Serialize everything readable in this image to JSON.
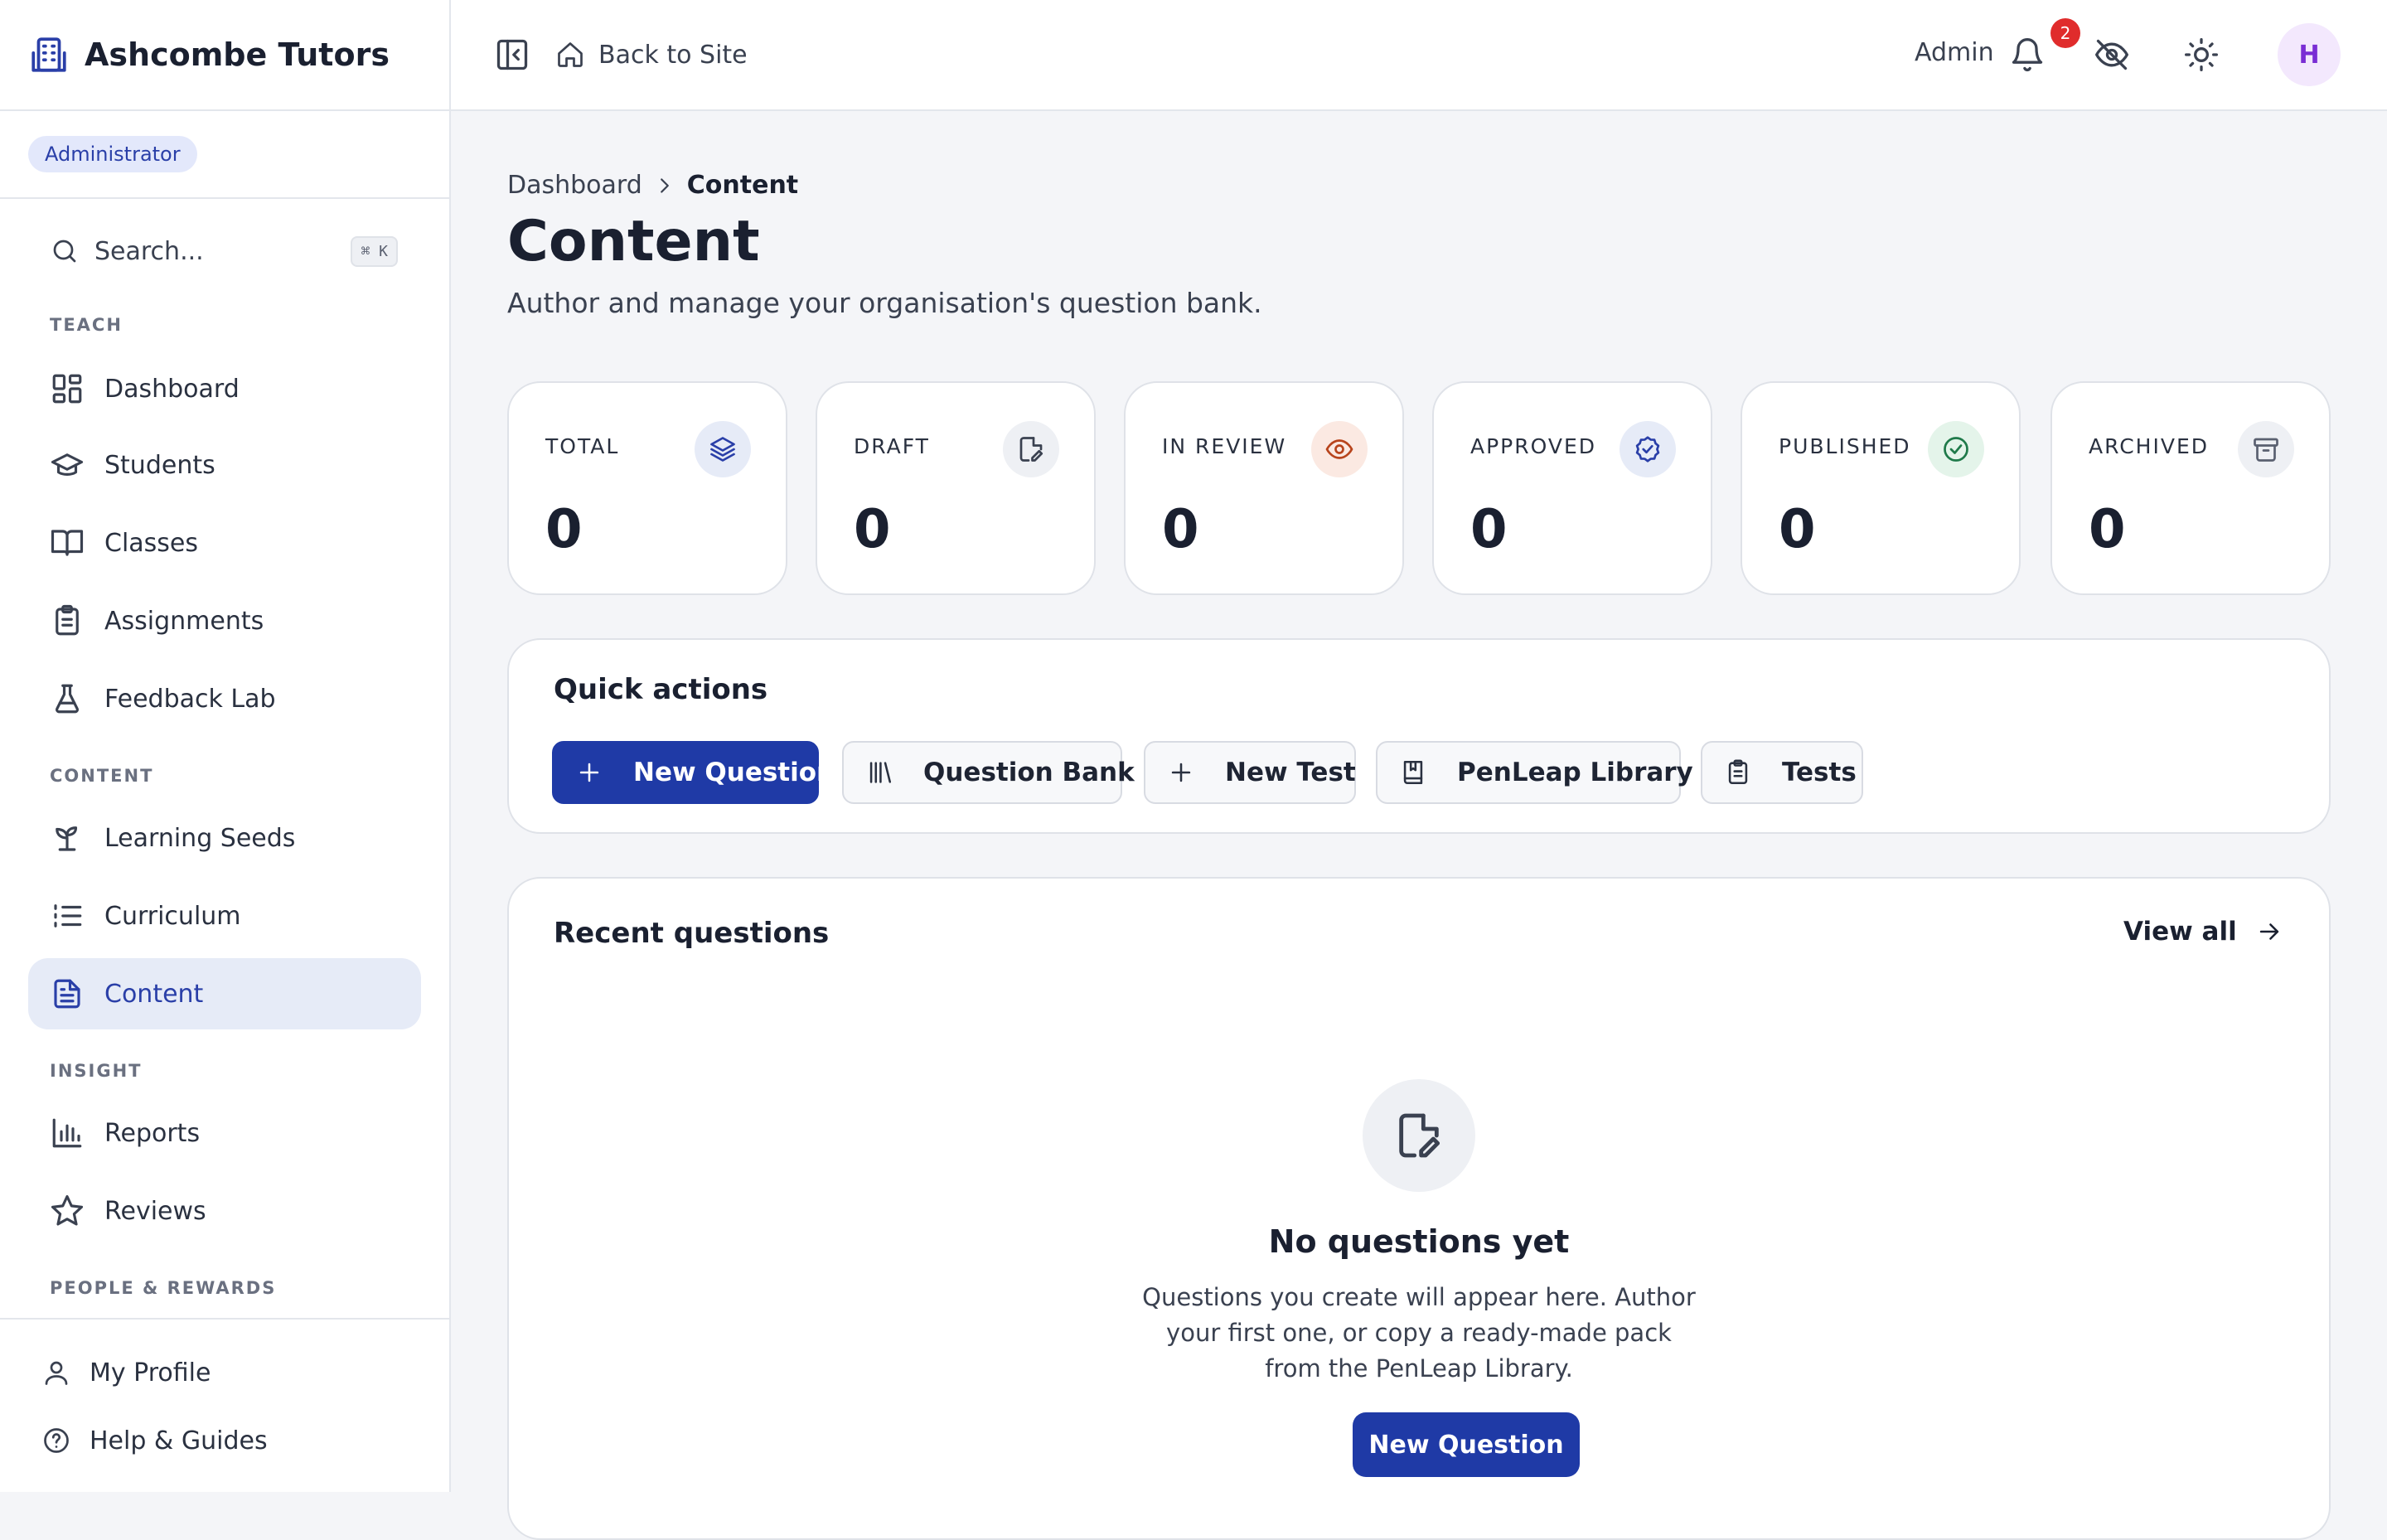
{
  "brand": {
    "name": "Ashcombe Tutors",
    "role": "Administrator"
  },
  "sidebar": {
    "search_label": "Search...",
    "search_shortcut": "⌘ K",
    "sections": [
      {
        "label": "TEACH"
      },
      {
        "label": "CONTENT"
      },
      {
        "label": "INSIGHT"
      },
      {
        "label": "PEOPLE & REWARDS"
      }
    ],
    "items": [
      {
        "label": "Dashboard",
        "icon": "dashboard-icon"
      },
      {
        "label": "Students",
        "icon": "graduation-cap-icon"
      },
      {
        "label": "Classes",
        "icon": "book-open-icon"
      },
      {
        "label": "Assignments",
        "icon": "clipboard-icon"
      },
      {
        "label": "Feedback Lab",
        "icon": "flask-icon"
      },
      {
        "label": "Learning Seeds",
        "icon": "sprout-icon"
      },
      {
        "label": "Curriculum",
        "icon": "list-icon"
      },
      {
        "label": "Content",
        "icon": "file-text-icon",
        "active": true
      },
      {
        "label": "Reports",
        "icon": "bar-chart-icon"
      },
      {
        "label": "Reviews",
        "icon": "star-icon"
      }
    ],
    "bottom": [
      {
        "label": "My Profile",
        "icon": "user-icon"
      },
      {
        "label": "Help & Guides",
        "icon": "help-circle-icon"
      }
    ]
  },
  "topbar": {
    "back_label": "Back to Site",
    "user_label": "Admin",
    "notification_count": "2",
    "avatar_initial": "H"
  },
  "breadcrumb": {
    "parent": "Dashboard",
    "current": "Content"
  },
  "page": {
    "title": "Content",
    "subtitle": "Author and manage your organisation's question bank."
  },
  "stats": [
    {
      "label": "TOTAL",
      "value": "0",
      "icon": "layers-icon",
      "color": "#2a3fa8",
      "bg": "#e6ebf7"
    },
    {
      "label": "DRAFT",
      "value": "0",
      "icon": "file-edit-icon",
      "color": "#3a4150",
      "bg": "#eef0f4"
    },
    {
      "label": "IN REVIEW",
      "value": "0",
      "icon": "eye-icon",
      "color": "#b8441c",
      "bg": "#fbe9e2"
    },
    {
      "label": "APPROVED",
      "value": "0",
      "icon": "badge-check-icon",
      "color": "#2a3fa8",
      "bg": "#e6ebf7"
    },
    {
      "label": "PUBLISHED",
      "value": "0",
      "icon": "check-circle-icon",
      "color": "#1f7a4a",
      "bg": "#e4f4ea"
    },
    {
      "label": "ARCHIVED",
      "value": "0",
      "icon": "archive-icon",
      "color": "#5a6070",
      "bg": "#eef0f4"
    }
  ],
  "quick_actions": {
    "title": "Quick actions",
    "buttons": [
      {
        "label": "New Question",
        "icon": "plus-icon",
        "primary": true
      },
      {
        "label": "Question Bank",
        "icon": "library-icon"
      },
      {
        "label": "New Test",
        "icon": "plus-icon"
      },
      {
        "label": "PenLeap Library",
        "icon": "bookmark-book-icon"
      },
      {
        "label": "Tests",
        "icon": "clipboard-icon"
      }
    ]
  },
  "recent": {
    "title": "Recent questions",
    "view_all": "View all",
    "empty_title": "No questions yet",
    "empty_desc": "Questions you create will appear here. Author your first one, or copy a ready-made pack from the PenLeap Library.",
    "empty_cta": "New Question"
  },
  "colors": {
    "accent": "#1f3aa6",
    "active_nav_bg": "#e6ebf7",
    "badge_red": "#e02c2c"
  }
}
